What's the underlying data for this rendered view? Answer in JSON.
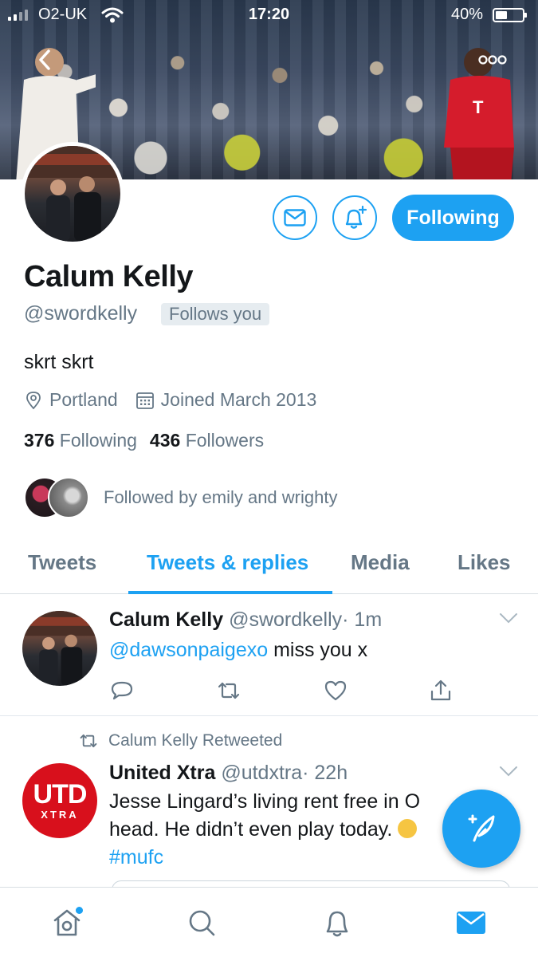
{
  "status_bar": {
    "carrier": "O2-UK",
    "time": "17:20",
    "battery": "40%"
  },
  "profile": {
    "name": "Calum Kelly",
    "handle": "@swordkelly",
    "follows_you": "Follows you",
    "bio": "skrt skrt",
    "location": "Portland",
    "joined": "Joined March 2013",
    "following_count": "376",
    "following_label": "Following",
    "followers_count": "436",
    "followers_label": "Followers",
    "followed_by": "Followed by emily and wrighty"
  },
  "actions": {
    "following_button": "Following"
  },
  "tabs": [
    {
      "label": "Tweets",
      "active": false
    },
    {
      "label": "Tweets & replies",
      "active": true
    },
    {
      "label": "Media",
      "active": false
    },
    {
      "label": "Likes",
      "active": false
    }
  ],
  "tweets": [
    {
      "name": "Calum Kelly",
      "handle": "@swordkelly",
      "time": "· 1m",
      "mention": "@dawsonpaigexo",
      "text": " miss you x"
    },
    {
      "retweeted_by": "Calum Kelly Retweeted",
      "name": "United Xtra",
      "handle": "@utdxtra",
      "time": "· 22h",
      "avatar_big": "UTD",
      "avatar_small": "XTRA",
      "text": "Jesse Lingard’s living rent free in O",
      "text2": "head. He didn’t even play today.",
      "hashtag": "#mufc"
    }
  ],
  "icons": {
    "back": "chevron-left-icon",
    "more": "more-icon",
    "message": "envelope-icon",
    "notify": "bell-plus-icon",
    "location": "location-pin-icon",
    "calendar": "calendar-icon",
    "reply": "reply-icon",
    "retweet": "retweet-icon",
    "like": "heart-icon",
    "share": "share-icon",
    "compose": "compose-icon",
    "home": "home-icon",
    "search": "search-icon",
    "notifications": "bell-icon",
    "messages": "mail-icon"
  },
  "colors": {
    "accent": "#1da1f2",
    "text": "#14171a",
    "muted": "#657786",
    "utd_red": "#d8101c"
  }
}
